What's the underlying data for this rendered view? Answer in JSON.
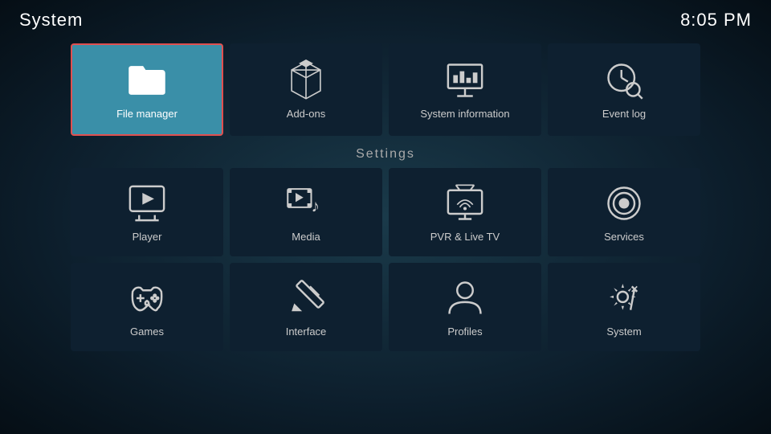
{
  "header": {
    "title": "System",
    "time": "8:05 PM"
  },
  "top_row": [
    {
      "id": "file-manager",
      "label": "File manager",
      "icon": "folder",
      "active": true
    },
    {
      "id": "add-ons",
      "label": "Add-ons",
      "icon": "box",
      "active": false
    },
    {
      "id": "system-information",
      "label": "System information",
      "icon": "presentation",
      "active": false
    },
    {
      "id": "event-log",
      "label": "Event log",
      "icon": "clock-search",
      "active": false
    }
  ],
  "settings_label": "Settings",
  "settings_rows": [
    [
      {
        "id": "player",
        "label": "Player",
        "icon": "play"
      },
      {
        "id": "media",
        "label": "Media",
        "icon": "media"
      },
      {
        "id": "pvr-live-tv",
        "label": "PVR & Live TV",
        "icon": "tv"
      },
      {
        "id": "services",
        "label": "Services",
        "icon": "podcast"
      }
    ],
    [
      {
        "id": "games",
        "label": "Games",
        "icon": "gamepad"
      },
      {
        "id": "interface",
        "label": "Interface",
        "icon": "pencil"
      },
      {
        "id": "profiles",
        "label": "Profiles",
        "icon": "user"
      },
      {
        "id": "system",
        "label": "System",
        "icon": "gear-fork"
      }
    ]
  ]
}
